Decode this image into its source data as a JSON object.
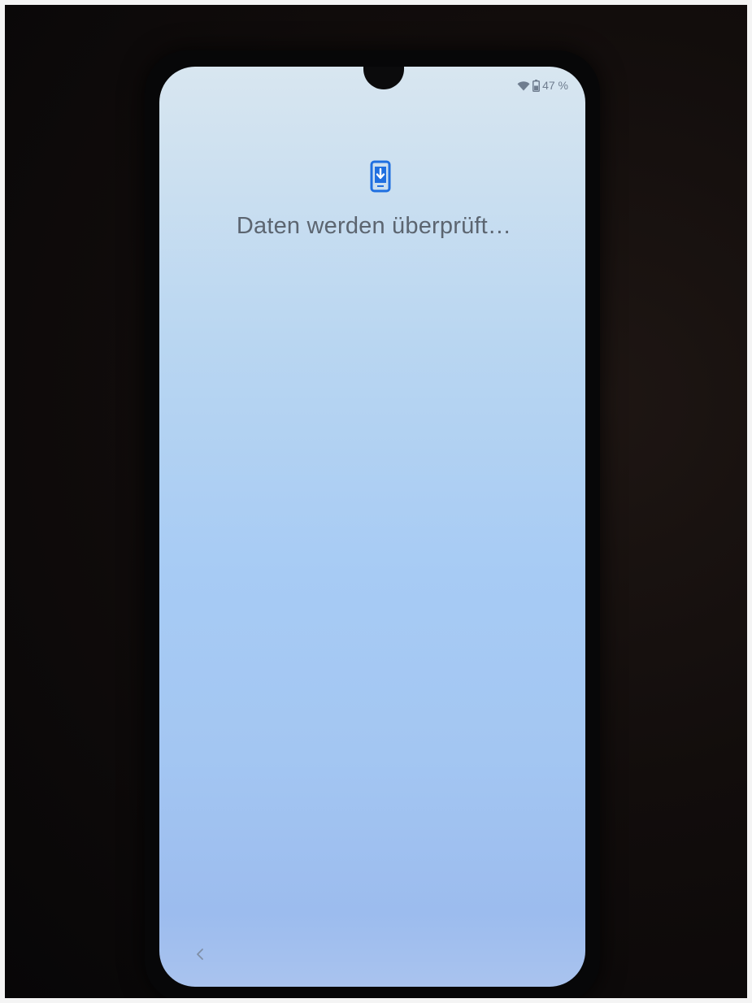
{
  "status_bar": {
    "battery_text": "47 %",
    "icons": [
      "wifi-icon",
      "battery-icon"
    ]
  },
  "setup_screen": {
    "icon": "phone-download-icon",
    "message": "Daten werden überprüft…"
  },
  "navigation": {
    "back_icon": "chevron-left-icon"
  },
  "colors": {
    "accent": "#1f6fe0",
    "text": "#5c6570"
  }
}
